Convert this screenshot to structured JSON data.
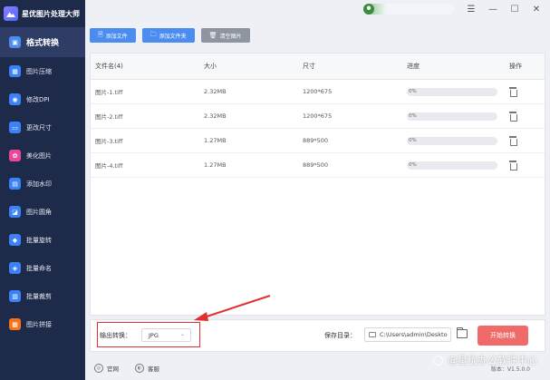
{
  "app": {
    "title": "星优图片处理大师"
  },
  "sidebar": {
    "items": [
      {
        "label": "格式转换",
        "icon": "image-convert-icon",
        "color": "#4a8cf0",
        "active": true
      },
      {
        "label": "图片压缩",
        "icon": "compress-icon",
        "color": "#3b82f6"
      },
      {
        "label": "修改DPI",
        "icon": "dpi-icon",
        "color": "#3b82f6"
      },
      {
        "label": "更改尺寸",
        "icon": "resize-icon",
        "color": "#3b82f6"
      },
      {
        "label": "美化图片",
        "icon": "beautify-icon",
        "color": "#ec4899"
      },
      {
        "label": "添加水印",
        "icon": "watermark-icon",
        "color": "#3b82f6"
      },
      {
        "label": "图片圆角",
        "icon": "round-corner-icon",
        "color": "#3b82f6"
      },
      {
        "label": "批量旋转",
        "icon": "rotate-icon",
        "color": "#3b82f6"
      },
      {
        "label": "批量命名",
        "icon": "rename-icon",
        "color": "#3b82f6"
      },
      {
        "label": "批量裁剪",
        "icon": "crop-icon",
        "color": "#3b82f6"
      },
      {
        "label": "图片拼接",
        "icon": "stitch-icon",
        "color": "#f97316"
      }
    ]
  },
  "toolbar": {
    "add_file": "添加文件",
    "add_folder": "添加文件夹",
    "clear": "清空图片"
  },
  "table": {
    "headers": {
      "name": "文件名(4)",
      "size": "大小",
      "dimensions": "尺寸",
      "progress": "进度",
      "action": "操作"
    },
    "rows": [
      {
        "name": "图片-1.tiff",
        "size": "2.32MB",
        "dimensions": "1200*675",
        "progress": "0%",
        "progress_value": 0
      },
      {
        "name": "图片-2.tiff",
        "size": "2.32MB",
        "dimensions": "1200*675",
        "progress": "0%",
        "progress_value": 0
      },
      {
        "name": "图片-3.tiff",
        "size": "1.27MB",
        "dimensions": "889*500",
        "progress": "0%",
        "progress_value": 0
      },
      {
        "name": "图片-4.tiff",
        "size": "1.27MB",
        "dimensions": "889*500",
        "progress": "0%",
        "progress_value": 0
      }
    ]
  },
  "output": {
    "format_label": "输出转换：",
    "format_value": "JPG",
    "save_label": "保存目录：",
    "save_path": "C:\\Users\\admin\\Deskto",
    "start_label": "开始转换"
  },
  "footer": {
    "official": "官网",
    "service": "客服",
    "version": "版本：V1.5.0.0"
  },
  "watermark": {
    "text": "@星优办公软件中心"
  },
  "colors": {
    "accent": "#4a8cf0",
    "sidebar_bg": "#1e2a4a",
    "start_button": "#f06a6a",
    "highlight_box": "#e03030"
  }
}
